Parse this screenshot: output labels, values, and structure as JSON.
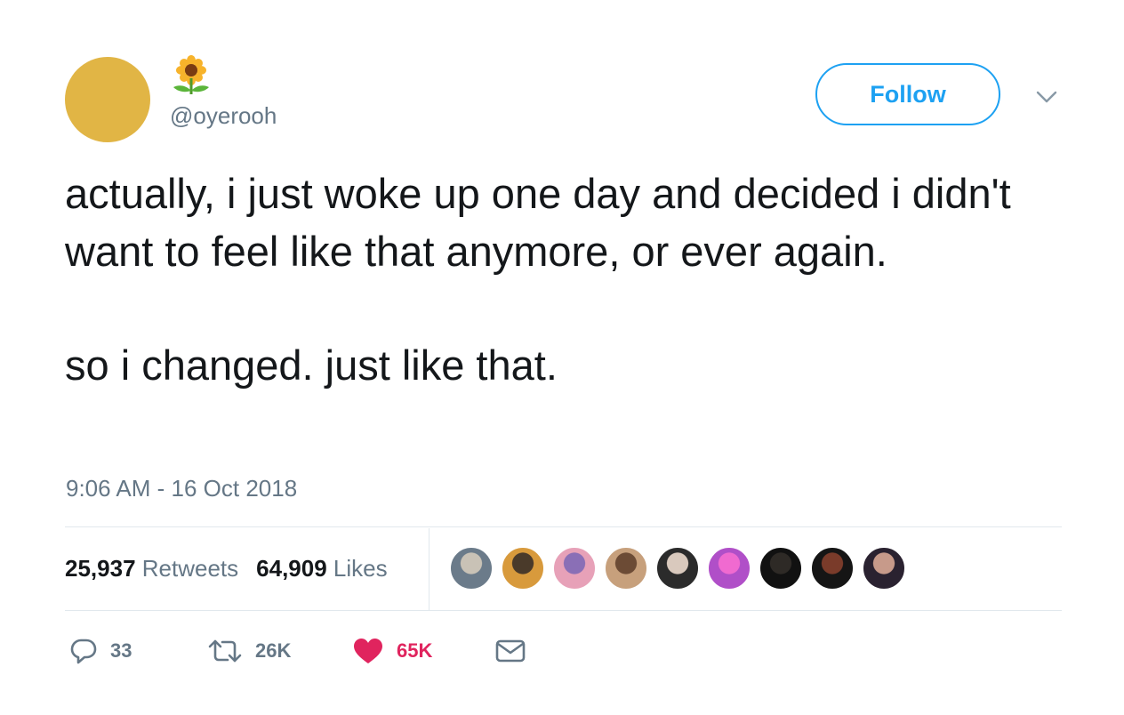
{
  "profile": {
    "handle": "@oyerooh",
    "avatar_color": "#e1b545",
    "name_icon": "sunflower-icon"
  },
  "follow_button": {
    "label": "Follow",
    "color": "#1da1f2"
  },
  "menu_icon": "chevron-down-icon",
  "tweet": {
    "paragraphs": [
      "actually, i just woke up one day and decided i didn't want to feel like that anymore, or ever again.",
      "so i changed. just like that."
    ],
    "timestamp": "9:06 AM - 16 Oct 2018"
  },
  "stats": {
    "retweets_count": "25,937",
    "retweets_label": "Retweets",
    "likes_count": "64,909",
    "likes_label": "Likes"
  },
  "liker_avatars": [
    {
      "colors": [
        "#6b7b8a",
        "#c9c2b6"
      ]
    },
    {
      "colors": [
        "#d89a3c",
        "#4a3a2a"
      ]
    },
    {
      "colors": [
        "#e7a1b8",
        "#8a6fb6"
      ]
    },
    {
      "colors": [
        "#c7a07c",
        "#6c4b35"
      ]
    },
    {
      "colors": [
        "#2b2b2b",
        "#d9c9bd"
      ]
    },
    {
      "colors": [
        "#b04fc8",
        "#f06ad0"
      ]
    },
    {
      "colors": [
        "#111111",
        "#2e2a26"
      ]
    },
    {
      "colors": [
        "#151515",
        "#7a3b2a"
      ]
    },
    {
      "colors": [
        "#2a2230",
        "#c79a8a"
      ]
    }
  ],
  "actions": {
    "reply": {
      "icon": "reply-icon",
      "count": "33"
    },
    "retweet": {
      "icon": "retweet-icon",
      "count": "26K"
    },
    "like": {
      "icon": "heart-icon",
      "count": "65K",
      "color": "#e0245e"
    },
    "message": {
      "icon": "mail-icon"
    }
  }
}
